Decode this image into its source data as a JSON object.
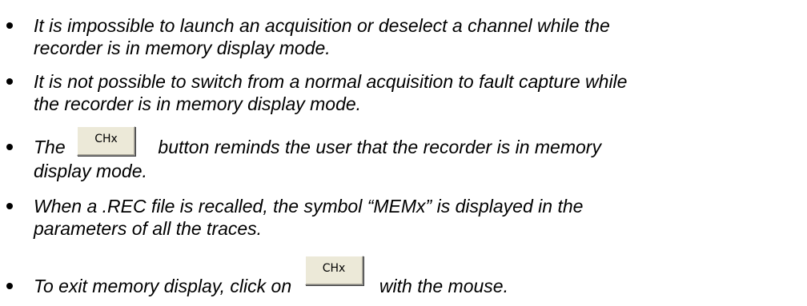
{
  "bullets": [
    {
      "line1": "It is impossible to launch an acquisition or deselect a channel while the",
      "line2": "recorder is in memory display mode."
    },
    {
      "line1": "It is not possible to switch from a normal acquisition to  fault capture while",
      "line2": "the recorder is in memory display mode."
    },
    {
      "pre": "The",
      "button_label": "CHx",
      "post": "button reminds the user that the recorder is in memory",
      "line2": "display mode."
    },
    {
      "line1": "When a .REC file is recalled, the symbol “MEMx” is displayed in the",
      "line2": "parameters of all the traces."
    },
    {
      "pre": "To exit memory display, click on",
      "button_label": "CHx",
      "post": "with the mouse."
    }
  ]
}
